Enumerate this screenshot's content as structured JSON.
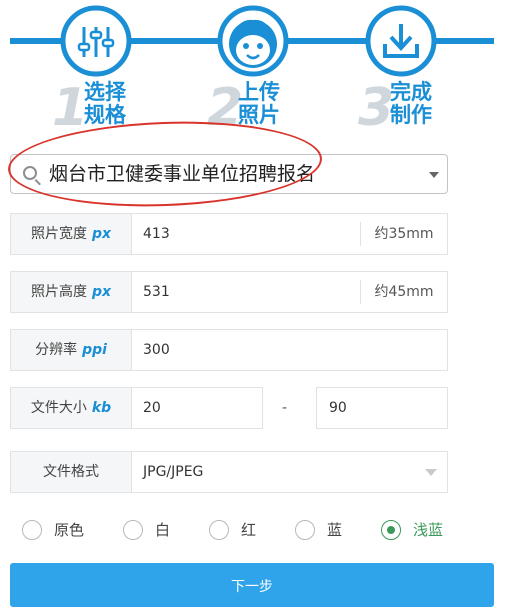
{
  "steps": [
    {
      "number": "1",
      "line1": "选择",
      "line2": "规格",
      "icon": "sliders-icon"
    },
    {
      "number": "2",
      "line1": "上传",
      "line2": "照片",
      "icon": "face-icon"
    },
    {
      "number": "3",
      "line1": "完成",
      "line2": "制作",
      "icon": "download-icon"
    }
  ],
  "spec_select": {
    "value": "烟台市卫健委事业单位招聘报名"
  },
  "fields": {
    "width": {
      "label": "照片宽度",
      "unit": "px",
      "value": "413",
      "suffix": "约35mm"
    },
    "height": {
      "label": "照片高度",
      "unit": "px",
      "value": "531",
      "suffix": "约45mm"
    },
    "resolution": {
      "label": "分辨率",
      "unit": "ppi",
      "value": "300"
    },
    "filesize": {
      "label": "文件大小",
      "unit": "kb",
      "min": "20",
      "separator": "-",
      "max": "90"
    },
    "format": {
      "label": "文件格式",
      "value": "JPG/JPEG"
    }
  },
  "backgrounds": [
    {
      "label": "原色",
      "selected": false
    },
    {
      "label": "白",
      "selected": false
    },
    {
      "label": "红",
      "selected": false
    },
    {
      "label": "蓝",
      "selected": false
    },
    {
      "label": "浅蓝",
      "selected": true
    }
  ],
  "next_button": "下一步",
  "colors": {
    "accent": "#1a8fd6",
    "button": "#2fa4ea",
    "selected": "#3a9a5b",
    "annotation": "#d9342b"
  }
}
